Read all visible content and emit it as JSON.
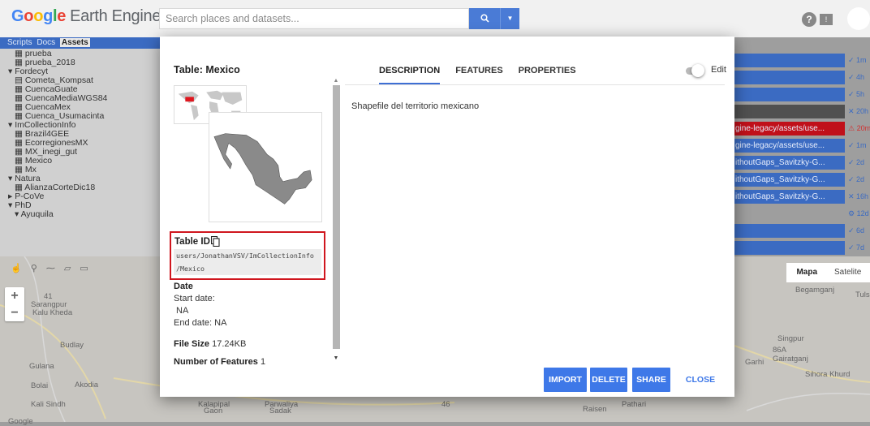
{
  "header": {
    "logo_word": [
      "G",
      "o",
      "o",
      "g",
      "l",
      "e"
    ],
    "logo_rest": "Earth Engine",
    "search_placeholder": "Search places and datasets...",
    "search_icon": "search-icon",
    "help_label": "?"
  },
  "left_panel": {
    "tabs": [
      "Scripts",
      "Docs",
      "Assets"
    ],
    "active_tab": "Assets",
    "tree": [
      {
        "text": "▦ prueba",
        "indent": 2
      },
      {
        "text": "▦ prueba_2018",
        "indent": 2
      },
      {
        "text": "▾ Fordecyt",
        "indent": 1
      },
      {
        "text": "▤ Cometa_Kompsat",
        "indent": 2
      },
      {
        "text": "▦ CuencaGuate",
        "indent": 2
      },
      {
        "text": "▦ CuencaMediaWGS84",
        "indent": 2
      },
      {
        "text": "▦ CuencaMex",
        "indent": 2
      },
      {
        "text": "▦ Cuenca_Usumacinta",
        "indent": 2
      },
      {
        "text": "▾ ImCollectionInfo",
        "indent": 1
      },
      {
        "text": "▦ Brazil4GEE",
        "indent": 2
      },
      {
        "text": "▦ EcorregionesMX",
        "indent": 2
      },
      {
        "text": "▦ MX_inegi_gut",
        "indent": 2
      },
      {
        "text": "▦ Mexico",
        "indent": 2
      },
      {
        "text": "▦ Mx",
        "indent": 2
      },
      {
        "text": "▾ Natura",
        "indent": 1
      },
      {
        "text": "▦ AlianzaCorteDic18",
        "indent": 2
      },
      {
        "text": "▸ P-CoVe",
        "indent": 1
      },
      {
        "text": "▾ PhD",
        "indent": 1
      },
      {
        "text": "▾ Ayuquila",
        "indent": 2
      }
    ]
  },
  "map": {
    "labels": [
      "Sarangpur",
      "Kalu Kheda",
      "Budlay",
      "Gulana",
      "Bolai",
      "Akodia",
      "Kali Sindh",
      "Kalapipal",
      "Gaon",
      "Parwaliya",
      "Sadak",
      "Raisen",
      "Pathari",
      "Begamganj",
      "Singpur",
      "Gairatganj",
      "Garhi",
      "Sihora Khurd",
      "Tuls",
      "41",
      "86A",
      "46",
      "Google"
    ],
    "map_type_options": [
      "Mapa",
      "Satelite"
    ],
    "map_type_selected": "Mapa",
    "draw_tools": "☝ ⚲ ⁓ ▱ ▭"
  },
  "tasks": [
    {
      "text": "",
      "status": "✓ 1m",
      "color": "#3b6bc2",
      "status_color": "#3b6bc2"
    },
    {
      "text": "",
      "status": "✓ 4h",
      "color": "#3b6bc2",
      "status_color": "#3b6bc2"
    },
    {
      "text": "",
      "status": "✓ 5h",
      "color": "#3b6bc2",
      "status_color": "#3b6bc2"
    },
    {
      "text": "",
      "status": "✕ 20h",
      "color": "#505050",
      "status_color": "#3b6bc2"
    },
    {
      "text": "gine-legacy/assets/use...",
      "status": "⚠ 20m",
      "color": "#c0101a",
      "status_color": "#d23030"
    },
    {
      "text": "gine-legacy/assets/use...",
      "status": "✓ 1m",
      "color": "#3b6bc2",
      "status_color": "#3b6bc2"
    },
    {
      "text": "ithoutGaps_Savitzky-G...",
      "status": "✓ 2d",
      "color": "#3b6bc2",
      "status_color": "#3b6bc2"
    },
    {
      "text": "ithoutGaps_Savitzky-G...",
      "status": "✓ 2d",
      "color": "#3b6bc2",
      "status_color": "#3b6bc2"
    },
    {
      "text": "ithoutGaps_Savitzky-G...",
      "status": "✕ 16h",
      "color": "#3b6bc2",
      "status_color": "#3b6bc2"
    },
    {
      "text": "",
      "status": "⚙ 12d",
      "color": "transparent",
      "status_color": "#3b6bc2"
    },
    {
      "text": "",
      "status": "✓ 6d",
      "color": "#3b6bc2",
      "status_color": "#3b6bc2"
    },
    {
      "text": "",
      "status": "✓ 7d",
      "color": "#3b6bc2",
      "status_color": "#3b6bc2"
    }
  ],
  "modal": {
    "title": "Table: Mexico",
    "tabs": [
      "DESCRIPTION",
      "FEATURES",
      "PROPERTIES"
    ],
    "active_tab": "DESCRIPTION",
    "edit_label": "Edit",
    "description": "Shapefile del territorio mexicano",
    "table_id_label": "Table ID",
    "table_id_line1": "users/JonathanVSV/ImCollectionInfo",
    "table_id_line2": "/Mexico",
    "date_label": "Date",
    "start_date_label": "Start date:",
    "start_date_value": "NA",
    "end_date_label": "End date:",
    "end_date_value": "NA",
    "file_size_label": "File Size",
    "file_size_value": "17.24KB",
    "num_features_label": "Number of Features",
    "num_features_value": "1",
    "buttons": {
      "import": "IMPORT",
      "delete": "DELETE",
      "share": "SHARE",
      "close": "CLOSE"
    }
  },
  "colors": {
    "accent": "#3e78e8",
    "highlight_border": "#d0161e",
    "task_blue": "#3b6bc2"
  }
}
